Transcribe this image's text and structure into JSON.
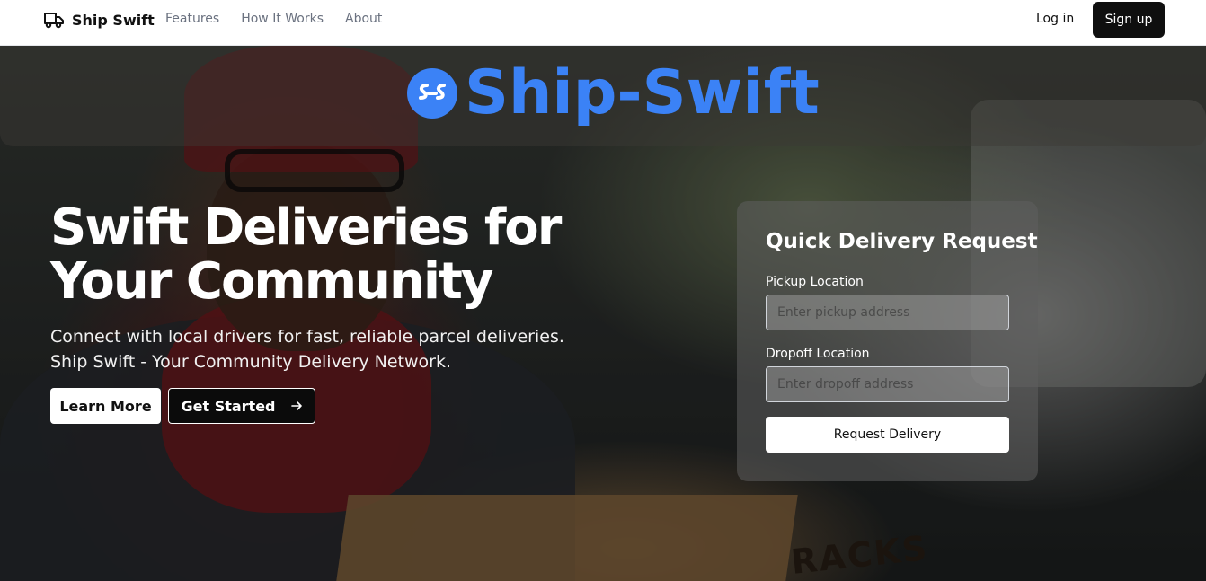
{
  "header": {
    "brand": "Ship Swift",
    "nav": [
      "Features",
      "How It Works",
      "About"
    ],
    "login": "Log in",
    "signup": "Sign up"
  },
  "hero": {
    "logo_text": "Ship-Swift",
    "headline": "Swift Deliveries for Your Community",
    "subtitle_line1": "Connect with local drivers for fast, reliable parcel deliveries.",
    "subtitle_line2": "Ship Swift - Your Community Delivery Network.",
    "learn_more": "Learn More",
    "get_started": "Get Started",
    "box_text": "RACKS"
  },
  "form": {
    "title": "Quick Delivery Request",
    "pickup_label": "Pickup Location",
    "pickup_placeholder": "Enter pickup address",
    "dropoff_label": "Dropoff Location",
    "dropoff_placeholder": "Enter dropoff address",
    "submit": "Request Delivery"
  },
  "colors": {
    "brand_blue": "#3b82f6",
    "dark_button": "#0f0f0f"
  },
  "icons": {
    "brand": "truck-icon",
    "logo": "ship-swift-logo-icon",
    "cta": "arrow-right-icon"
  }
}
